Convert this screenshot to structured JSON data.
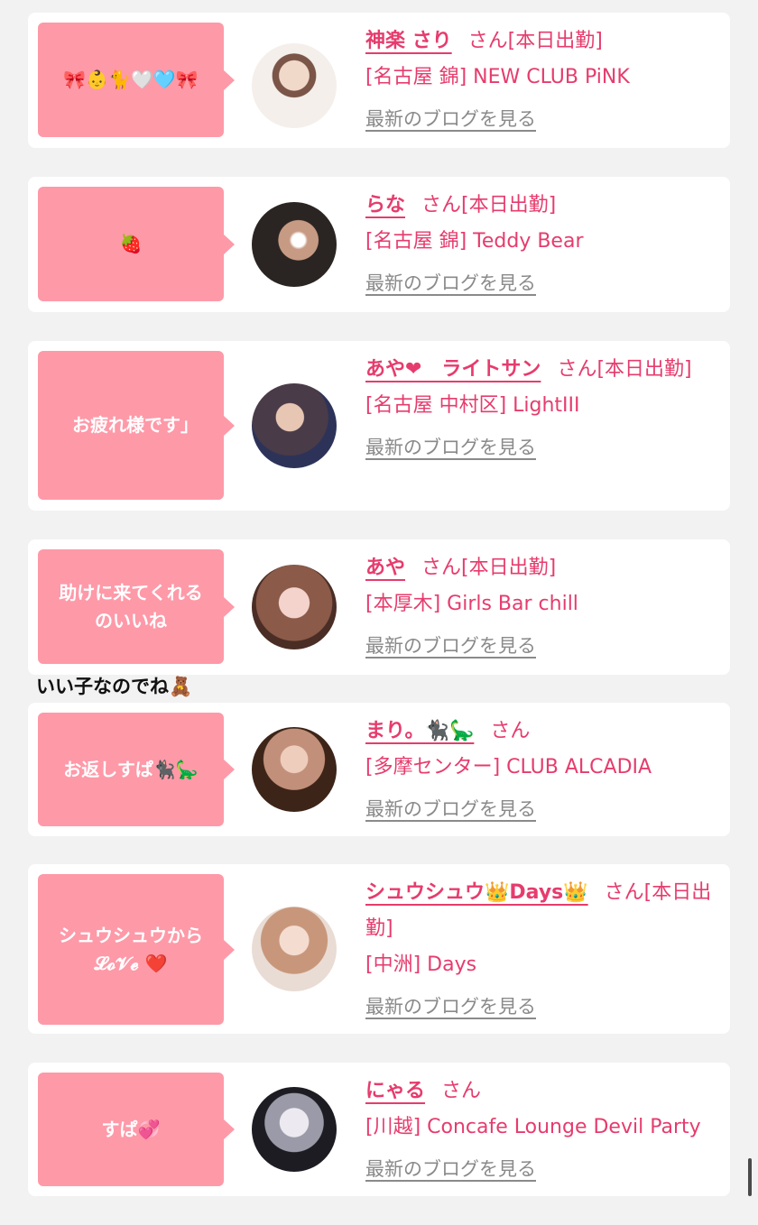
{
  "blog_link_label": "最新のブログを見る",
  "floating_text": "いい子なのでね🧸",
  "cards": [
    {
      "bubble": "🎀👶🐈🤍🩵🎀",
      "name": "神楽 さり",
      "suffix": "さん[本日出勤]",
      "shop": "[名古屋 錦] NEW CLUB PiNK",
      "avatar_colors": [
        "#f5eae2",
        "#d9b9a2"
      ]
    },
    {
      "bubble": "🍓",
      "name": "らな",
      "suffix": "さん[本日出勤]",
      "shop": "[名古屋 錦] Teddy Bear",
      "avatar_colors": [
        "#2a2522",
        "#a87a5c"
      ]
    },
    {
      "bubble": "お疲れ様です｣",
      "name": "あや❤︎　ライトサン",
      "suffix": "さん[本日出勤]",
      "shop": "[名古屋 中村区] LightIII",
      "avatar_colors": [
        "#3a3540",
        "#caa58d"
      ]
    },
    {
      "bubble": "助けに来てくれるのいいね",
      "name": "あや",
      "suffix": "さん[本日出勤]",
      "shop": "[本厚木] Girls Bar chill",
      "avatar_colors": [
        "#7a4a3a",
        "#efc9c0"
      ]
    },
    {
      "bubble": "お返しすぱ🐈‍⬛🦕",
      "name": "まり。🐈‍⬛🦕",
      "suffix": "さん",
      "shop": "[多摩センター] CLUB ALCADIA",
      "avatar_colors": [
        "#3d2418",
        "#d89a7a"
      ]
    },
    {
      "bubble": "シュウシュウから 𝓛𝓸𝓥𝓮 ❤️",
      "name": "シュウシュウ👑Days👑",
      "suffix": "さん[本日出勤]",
      "shop": "[中洲] Days",
      "avatar_colors": [
        "#e8d3c7",
        "#b98d74"
      ]
    },
    {
      "bubble": "すぱ💞",
      "name": "にゃる",
      "suffix": "さん",
      "shop": "[川越] Concafe Lounge Devil Party",
      "avatar_colors": [
        "#1c1c22",
        "#d7d7dc"
      ]
    }
  ]
}
